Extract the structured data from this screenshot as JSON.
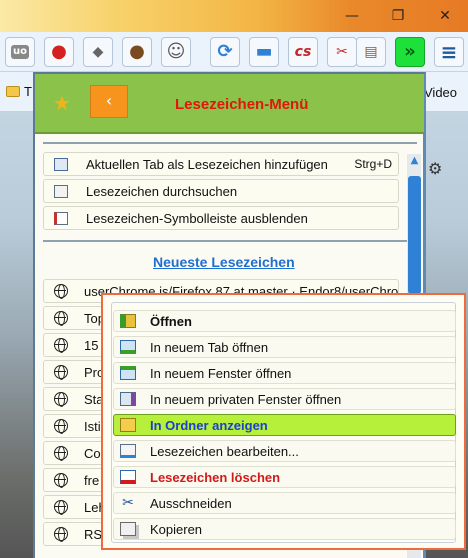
{
  "window": {
    "minimize": "—",
    "restore": "❐",
    "close": "✕"
  },
  "toolbar": {
    "buttons": [
      {
        "name": "ublock-icon",
        "glyph": "uo"
      },
      {
        "name": "addon-red-icon",
        "glyph": "●"
      },
      {
        "name": "addon-gray-icon",
        "glyph": "◆"
      },
      {
        "name": "cookie-icon",
        "glyph": "●"
      },
      {
        "name": "monkey-icon",
        "glyph": "☺"
      },
      {
        "name": "sync-icon",
        "glyph": "⟳"
      },
      {
        "name": "folder-icon",
        "glyph": "▬"
      },
      {
        "name": "addon-cs-icon",
        "glyph": "cs"
      },
      {
        "name": "tools-icon",
        "glyph": "✂"
      },
      {
        "name": "printer-icon",
        "glyph": "▤"
      }
    ],
    "overflow_glyph": "»",
    "menu_glyph": "≡"
  },
  "bookmarks_bar": {
    "first_folder_fragment": "T",
    "right_fragment": "Video"
  },
  "menu": {
    "title": "Lesezeichen-Menü",
    "back_glyph": "‹",
    "star_glyph": "★",
    "items": [
      {
        "label": "Aktuellen Tab als Lesezeichen hinzufügen",
        "shortcut": "Strg+D"
      },
      {
        "label": "Lesezeichen durchsuchen"
      },
      {
        "label": "Lesezeichen-Symbolleiste ausblenden"
      }
    ],
    "newest_label": "Neueste Lesezeichen",
    "bookmarks": [
      "userChrome.js/Firefox 87 at master · Endor8/userChrom",
      "Top",
      "15",
      "Pro",
      "Sta",
      "Isti",
      "Co",
      "fre",
      "Leh",
      "RSI"
    ]
  },
  "context_menu": {
    "items": [
      {
        "label": "Öffnen",
        "style": "bold"
      },
      {
        "label": "In neuem Tab öffnen"
      },
      {
        "label": "In neuem Fenster öffnen"
      },
      {
        "label": "In neuem privaten Fenster öffnen"
      },
      {
        "label": "In Ordner anzeigen",
        "style": "highlight"
      },
      {
        "label": "Lesezeichen bearbeiten..."
      },
      {
        "label": "Lesezeichen löschen",
        "style": "delete"
      },
      {
        "label": "Ausschneiden"
      },
      {
        "label": "Kopieren"
      }
    ]
  },
  "colors": {
    "menu_header": "#8bc34a",
    "title": "#e0170b",
    "back_button": "#f7941d",
    "highlight": "#b6f03a",
    "context_border": "#ef6a3d",
    "link": "#1f6fd0"
  }
}
